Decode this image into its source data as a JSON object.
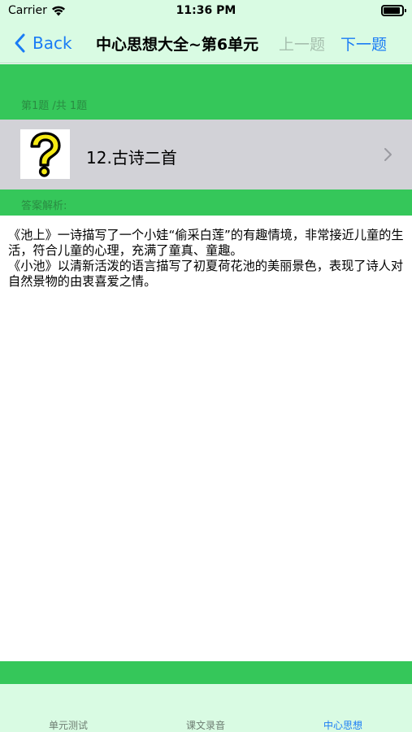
{
  "status_bar": {
    "carrier": "Carrier",
    "time": "11:36 PM"
  },
  "nav": {
    "back_label": "Back",
    "title": "中心思想大全~第6单元",
    "prev_label": "上一题",
    "next_label": "下一题"
  },
  "question": {
    "count_label": "第1题 /共 1题",
    "title": "12.古诗二首",
    "thumb_icon": "question-mark-icon"
  },
  "answer": {
    "label": "答案解析:",
    "text": "《池上》一诗描写了一个小娃“偷采白莲”的有趣情境，非常接近儿童的生活，符合儿童的心理，充满了童真、童趣。\n《小池》以清新活泼的语言描写了初夏荷花池的美丽景色，表现了诗人对自然景物的由衷喜爱之情。"
  },
  "tabs": [
    {
      "label": "单元测试",
      "active": false
    },
    {
      "label": "课文录音",
      "active": false
    },
    {
      "label": "中心思想",
      "active": true
    }
  ],
  "colors": {
    "accent": "#1a7cf5",
    "green": "#35c75a",
    "bar_bg": "#d9fbe3",
    "row_bg": "#d2d2d7",
    "disabled": "#a6bfae"
  }
}
